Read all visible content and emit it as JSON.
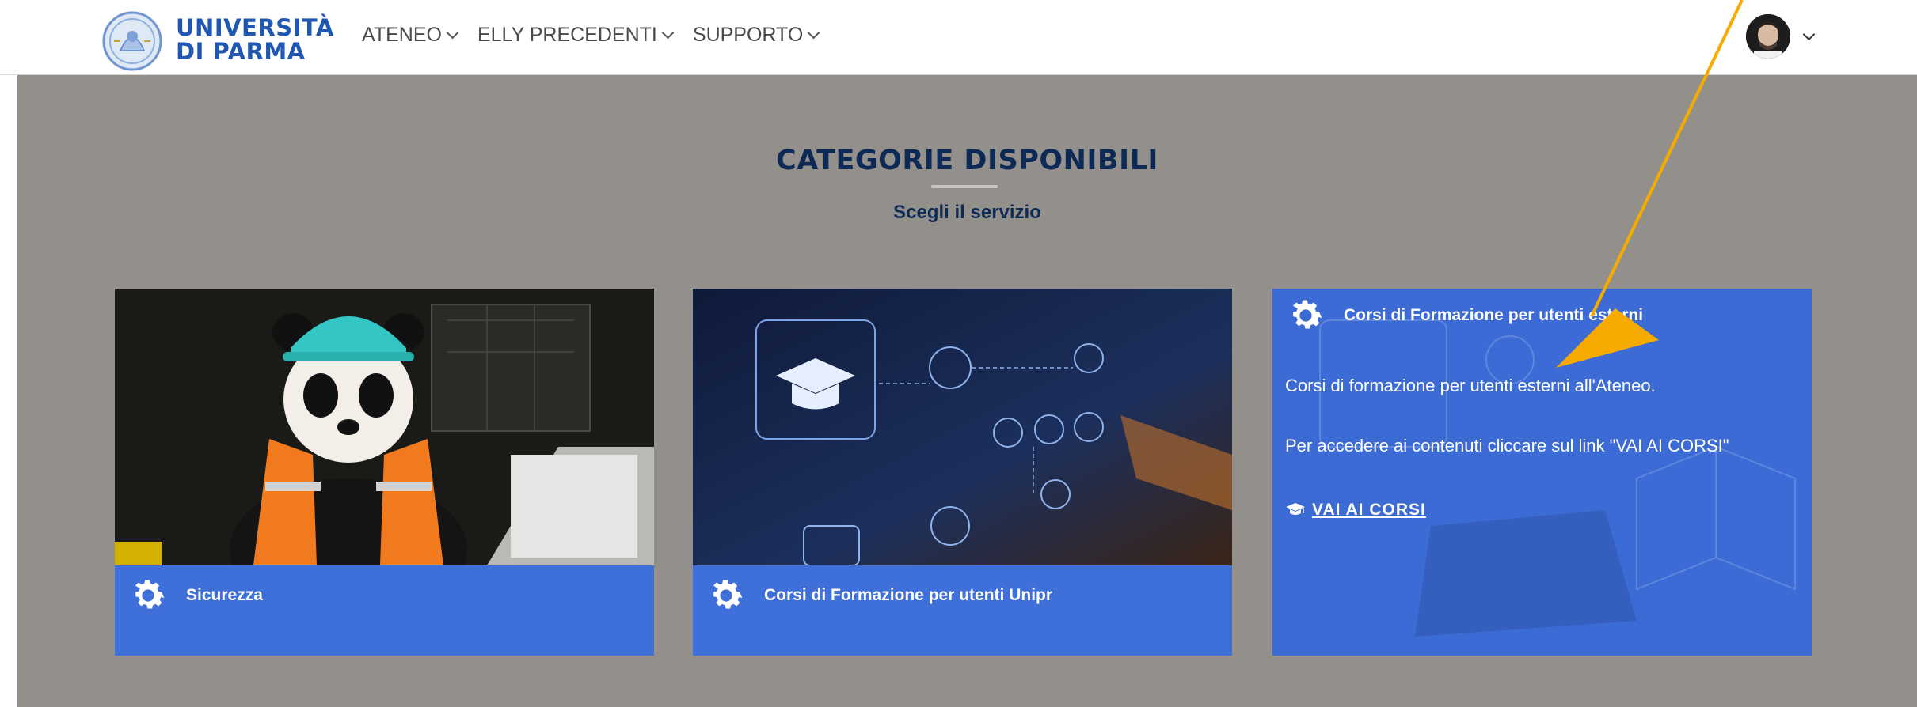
{
  "brand": {
    "line1": "UNIVERSITÀ",
    "line2": "DI PARMA"
  },
  "nav": {
    "items": [
      {
        "label": "ATENEO"
      },
      {
        "label": "ELLY PRECEDENTI"
      },
      {
        "label": "SUPPORTO"
      }
    ]
  },
  "section": {
    "title": "CATEGORIE DISPONIBILI",
    "subtitle": "Scegli il servizio"
  },
  "cards": [
    {
      "label": "Sicurezza",
      "icon": "gear-icon"
    },
    {
      "label": "Corsi di Formazione per utenti Unipr",
      "icon": "gear-icon"
    },
    {
      "label": "Corsi di Formazione per utenti esterni",
      "icon": "gear-icon",
      "description": "Corsi di formazione per utenti esterni all'Ateneo.",
      "instructions": "Per accedere ai contenuti cliccare sul link \"VAI AI CORSI\"",
      "link_label": "VAI AI CORSI",
      "link_icon": "graduation-cap-icon"
    }
  ],
  "colors": {
    "brand_blue": "#1f57b3",
    "title_navy": "#0d2a57",
    "card_blue": "#3f6fd9",
    "background_grey": "#938f8a",
    "annotation_orange": "#f7ab00"
  }
}
